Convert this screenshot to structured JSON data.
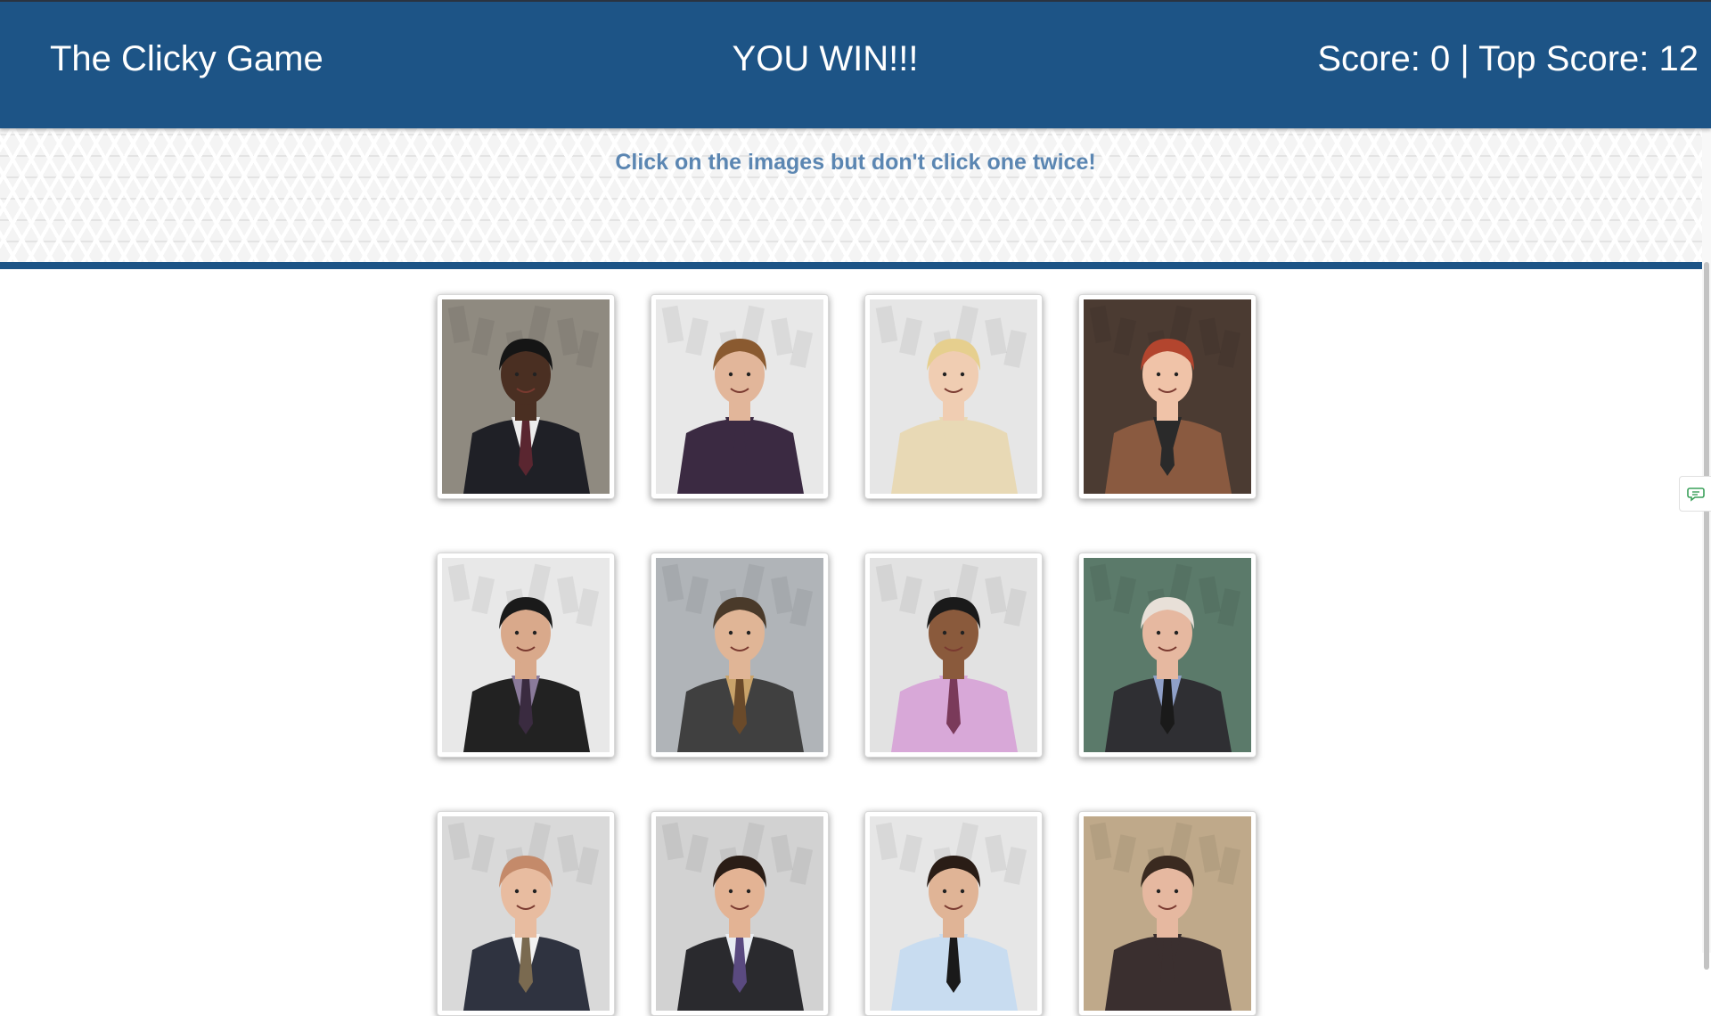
{
  "navbar": {
    "brand": "The Clicky Game",
    "message": "YOU WIN!!!",
    "score_text": "Score: 0 | Top Score: 12"
  },
  "header": {
    "subtitle": "Click on the images but don't click one twice!"
  },
  "colors": {
    "brand_blue": "#1d5486",
    "subtitle_blue": "#5b86b2"
  },
  "cards": [
    {
      "icon": "character-photo",
      "suit": "#1f2026",
      "skin": "#4a2f22",
      "hair": "#151515",
      "shirt": "#ececec",
      "tie": "#5a2630",
      "bg": "#8f8a80"
    },
    {
      "icon": "character-photo",
      "suit": "#3b2a42",
      "skin": "#e2b69a",
      "hair": "#8a5a30",
      "shirt": "#3b2a42",
      "tie": "#3b2a42",
      "bg": "#e8e8e8"
    },
    {
      "icon": "character-photo",
      "suit": "#e8d9b5",
      "skin": "#f0cdb2",
      "hair": "#e6cf8e",
      "shirt": "#e8d9b5",
      "tie": "#e8d9b5",
      "bg": "#e6e6e6"
    },
    {
      "icon": "character-photo",
      "suit": "#8a5a40",
      "skin": "#f0c3a8",
      "hair": "#b3452e",
      "shirt": "#2a2a2a",
      "tie": "#2a2a2a",
      "bg": "#4b3b32"
    },
    {
      "icon": "character-photo",
      "suit": "#222222",
      "skin": "#d9a98b",
      "hair": "#1a1a1a",
      "shirt": "#8a7a9a",
      "tie": "#3a2b40",
      "bg": "#e8e8e8"
    },
    {
      "icon": "character-photo",
      "suit": "#404040",
      "skin": "#e0b596",
      "hair": "#4a3a2a",
      "shirt": "#c9a36a",
      "tie": "#6a4a2a",
      "bg": "#b0b4b8"
    },
    {
      "icon": "character-photo",
      "suit": "#d8a8d8",
      "skin": "#8a5a3c",
      "hair": "#1a1a1a",
      "shirt": "#d8a8d8",
      "tie": "#7a3a5a",
      "bg": "#e2e2e2"
    },
    {
      "icon": "character-photo",
      "suit": "#2f2f33",
      "skin": "#e6b8a0",
      "hair": "#e8e0d8",
      "shirt": "#8fa0c8",
      "tie": "#1a1a1a",
      "bg": "#5b7a6a"
    },
    {
      "icon": "character-photo",
      "suit": "#2f3340",
      "skin": "#e8bca0",
      "hair": "#c48a6a",
      "shirt": "#f2f2f2",
      "tie": "#7a6a50",
      "bg": "#d9d9d9"
    },
    {
      "icon": "character-photo",
      "suit": "#2a2a2e",
      "skin": "#e3b394",
      "hair": "#2a1d16",
      "shirt": "#e8ecf2",
      "tie": "#5a4a80",
      "bg": "#d2d2d2"
    },
    {
      "icon": "character-photo",
      "suit": "#c8dcf0",
      "skin": "#e0b496",
      "hair": "#2a1d16",
      "shirt": "#c8dcf0",
      "tie": "#1a1a1a",
      "bg": "#e6e6e6"
    },
    {
      "icon": "character-photo",
      "suit": "#3a2f2f",
      "skin": "#e6b8a0",
      "hair": "#3a2a20",
      "shirt": "#3a2f2f",
      "tie": "#3a2f2f",
      "bg": "#bfa98a"
    }
  ]
}
